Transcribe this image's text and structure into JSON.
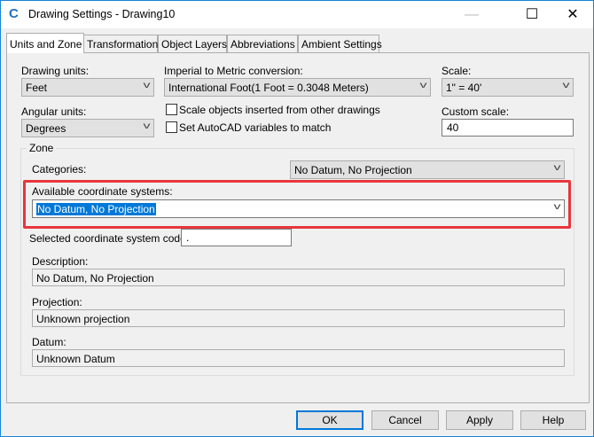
{
  "window": {
    "title": "Drawing Settings - Drawing10",
    "app_icon": "civil3d-c-icon",
    "logo_letter": "C"
  },
  "controls": {
    "minimize": "—",
    "maximize": "☐",
    "close": "✕"
  },
  "tabs": [
    "Units and Zone",
    "Transformation",
    "Object Layers",
    "Abbreviations",
    "Ambient Settings"
  ],
  "units": {
    "drawing_units_label": "Drawing units:",
    "drawing_units": "Feet",
    "conversion_label": "Imperial to Metric conversion:",
    "conversion": "International Foot(1 Foot = 0.3048 Meters)",
    "scale_label": "Scale:",
    "scale": "1\" = 40'",
    "angular_label": "Angular units:",
    "angular": "Degrees",
    "scale_objects_label": "Scale objects inserted from other drawings",
    "scale_objects_checked": false,
    "set_vars_label": "Set AutoCAD variables to match",
    "set_vars_checked": false,
    "custom_scale_label": "Custom scale:",
    "custom_scale": "40"
  },
  "zone": {
    "title": "Zone",
    "categories_label": "Categories:",
    "categories": "No Datum, No Projection",
    "available_label": "Available coordinate systems:",
    "available": "No Datum, No Projection",
    "code_label": "Selected coordinate system code:",
    "code": ".",
    "description_label": "Description:",
    "description": "No Datum, No Projection",
    "projection_label": "Projection:",
    "projection": "Unknown projection",
    "datum_label": "Datum:",
    "datum": "Unknown Datum"
  },
  "buttons": {
    "ok": "OK",
    "cancel": "Cancel",
    "apply": "Apply",
    "help": "Help"
  },
  "colors": {
    "highlight": "#e8363c",
    "accent": "#0078d7"
  }
}
